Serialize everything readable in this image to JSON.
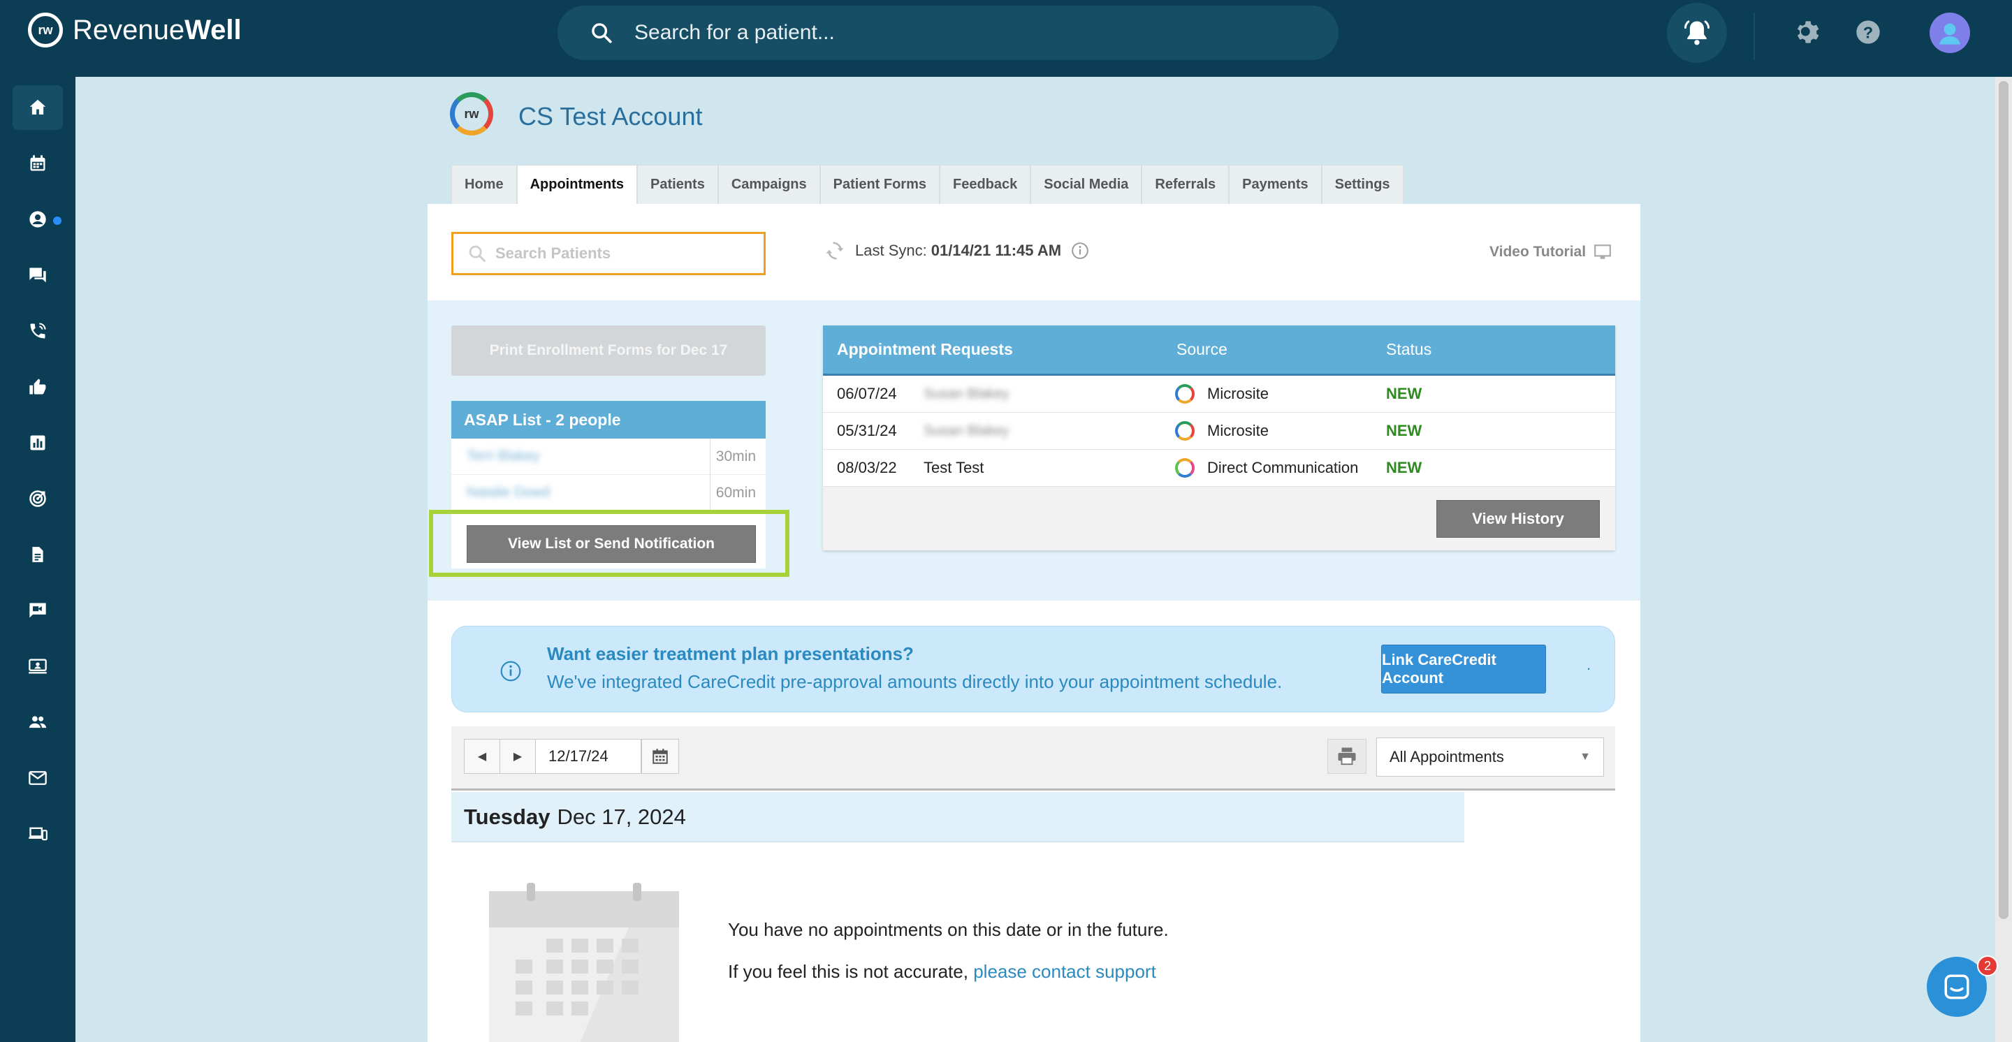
{
  "app": {
    "name_light": "Revenue",
    "name_bold": "Well",
    "logo_mark": "rw"
  },
  "top_search": {
    "placeholder": "Search for a patient..."
  },
  "sidebar": {
    "items": [
      "home-icon",
      "calendar-icon",
      "account-icon",
      "chat-icon",
      "phone-icon",
      "thumbs-up-icon",
      "chart-icon",
      "target-icon",
      "document-icon",
      "video-chat-icon",
      "screen-icon",
      "people-icon",
      "mail-icon",
      "devices-icon"
    ]
  },
  "account": {
    "title": "CS Test Account",
    "logo_mark": "rw"
  },
  "tabs": [
    "Home",
    "Appointments",
    "Patients",
    "Campaigns",
    "Patient Forms",
    "Feedback",
    "Social Media",
    "Referrals",
    "Payments",
    "Settings"
  ],
  "active_tab": "Appointments",
  "search_patients": {
    "placeholder": "Search Patients"
  },
  "sync": {
    "label": "Last Sync:",
    "value": "01/14/21 11:45 AM"
  },
  "video_tutorial": "Video Tutorial",
  "print_button": "Print Enrollment Forms for Dec 17",
  "asap": {
    "title": "ASAP List - 2 people",
    "rows": [
      {
        "name": "Terri Blakey",
        "duration": "30min"
      },
      {
        "name": "Natalie Dowd",
        "duration": "60min"
      }
    ],
    "button": "View List or Send Notification"
  },
  "requests": {
    "headers": [
      "Appointment Requests",
      "Source",
      "Status"
    ],
    "rows": [
      {
        "date": "06/07/24",
        "name": "Susan Blakey",
        "source": "Microsite",
        "status": "NEW"
      },
      {
        "date": "05/31/24",
        "name": "Susan Blakey",
        "source": "Microsite",
        "status": "NEW"
      },
      {
        "date": "08/03/22",
        "name": "Test Test",
        "source": "Direct Communication",
        "status": "NEW"
      }
    ],
    "view_history": "View History"
  },
  "banner": {
    "heading": "Want easier treatment plan presentations?",
    "text": "We've integrated CareCredit pre-approval amounts directly into your appointment schedule.",
    "button": "Link CareCredit Account",
    "trailing": "."
  },
  "datebar": {
    "date": "12/17/24",
    "filter": "All Appointments"
  },
  "day": {
    "weekday": "Tuesday",
    "date": "Dec 17, 2024"
  },
  "empty": {
    "message": "You have no appointments on this date or in the future.",
    "support_prefix": "If you feel this is not accurate,",
    "support_link": "please contact support"
  },
  "chat": {
    "badge": "2"
  },
  "colors": {
    "topbar": "#0b3d54",
    "accent": "#5faed8",
    "highlight": "#a8d23a",
    "status_new": "#2e8b1f"
  }
}
